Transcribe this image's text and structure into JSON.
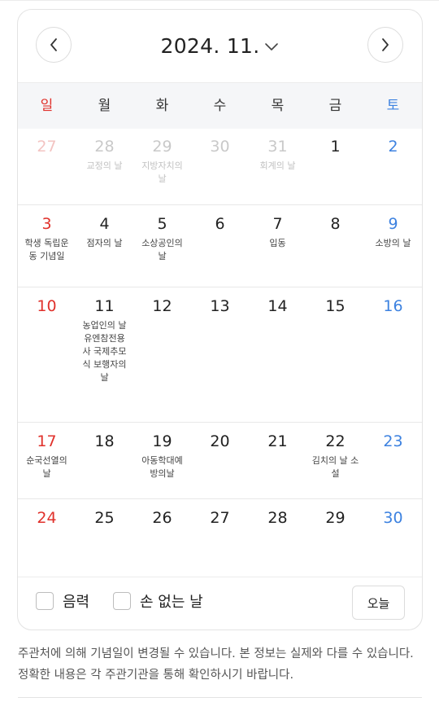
{
  "calendar": {
    "month_label": "2024. 11.",
    "weekdays": [
      "일",
      "월",
      "화",
      "수",
      "목",
      "금",
      "토"
    ],
    "weeks": [
      [
        {
          "day": "27",
          "note": ""
        },
        {
          "day": "28",
          "note": "교정의 날"
        },
        {
          "day": "29",
          "note": "지방자치의 날"
        },
        {
          "day": "30",
          "note": ""
        },
        {
          "day": "31",
          "note": "회계의 날"
        },
        {
          "day": "1",
          "note": ""
        },
        {
          "day": "2",
          "note": ""
        }
      ],
      [
        {
          "day": "3",
          "note": "학생 독립운동 기념일"
        },
        {
          "day": "4",
          "note": "점자의 날"
        },
        {
          "day": "5",
          "note": "소상공인의 날"
        },
        {
          "day": "6",
          "note": ""
        },
        {
          "day": "7",
          "note": "입동"
        },
        {
          "day": "8",
          "note": ""
        },
        {
          "day": "9",
          "note": "소방의 날"
        }
      ],
      [
        {
          "day": "10",
          "note": ""
        },
        {
          "day": "11",
          "note": "농업인의 날 유엔참전용사 국제추모식 보행자의 날"
        },
        {
          "day": "12",
          "note": ""
        },
        {
          "day": "13",
          "note": ""
        },
        {
          "day": "14",
          "note": ""
        },
        {
          "day": "15",
          "note": ""
        },
        {
          "day": "16",
          "note": ""
        }
      ],
      [
        {
          "day": "17",
          "note": "순국선열의 날"
        },
        {
          "day": "18",
          "note": ""
        },
        {
          "day": "19",
          "note": "아동학대예방의날"
        },
        {
          "day": "20",
          "note": ""
        },
        {
          "day": "21",
          "note": ""
        },
        {
          "day": "22",
          "note": "김치의 날 소설"
        },
        {
          "day": "23",
          "note": ""
        }
      ],
      [
        {
          "day": "24",
          "note": ""
        },
        {
          "day": "25",
          "note": ""
        },
        {
          "day": "26",
          "note": ""
        },
        {
          "day": "27",
          "note": ""
        },
        {
          "day": "28",
          "note": ""
        },
        {
          "day": "29",
          "note": ""
        },
        {
          "day": "30",
          "note": ""
        }
      ]
    ]
  },
  "footer": {
    "lunar_label": "음력",
    "no_hands_label": "손 없는 날",
    "today_button": "오늘"
  },
  "disclaimer": "주관처에 의해 기념일이 변경될 수 있습니다. 본 정보는 실제와 다를 수 있습니다. 정확한 내용은 각 주관기관을 통해 확인하시기 바랍니다.",
  "colors": {
    "sunday": "#e0312b",
    "saturday": "#3d82e0",
    "weekday_header_bg": "#f5f6f8"
  },
  "icons": {
    "prev": "chevron-left-icon",
    "next": "chevron-right-icon",
    "month_dropdown": "chevron-down-icon"
  }
}
